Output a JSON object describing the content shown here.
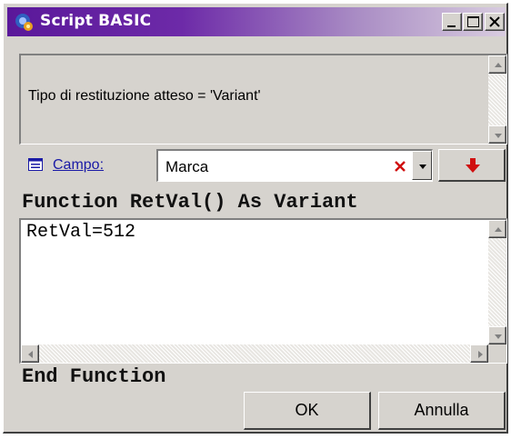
{
  "window": {
    "title": "Script BASIC"
  },
  "message": {
    "text": "Tipo di restituzione atteso = 'Variant'"
  },
  "field": {
    "label": "Campo:",
    "value": "Marca"
  },
  "code": {
    "header": "Function RetVal() As Variant",
    "body": "RetVal=512",
    "footer": "End Function"
  },
  "buttons": {
    "ok": "OK",
    "cancel": "Annulla"
  },
  "icons": {
    "app": "script-gear-icon",
    "field": "field-list-icon",
    "clear": "red-x-icon",
    "insert": "red-down-arrow-icon"
  },
  "colors": {
    "title_gradient_start": "#5a189a",
    "link": "#1a1aa6",
    "accent_red": "#d01010"
  }
}
